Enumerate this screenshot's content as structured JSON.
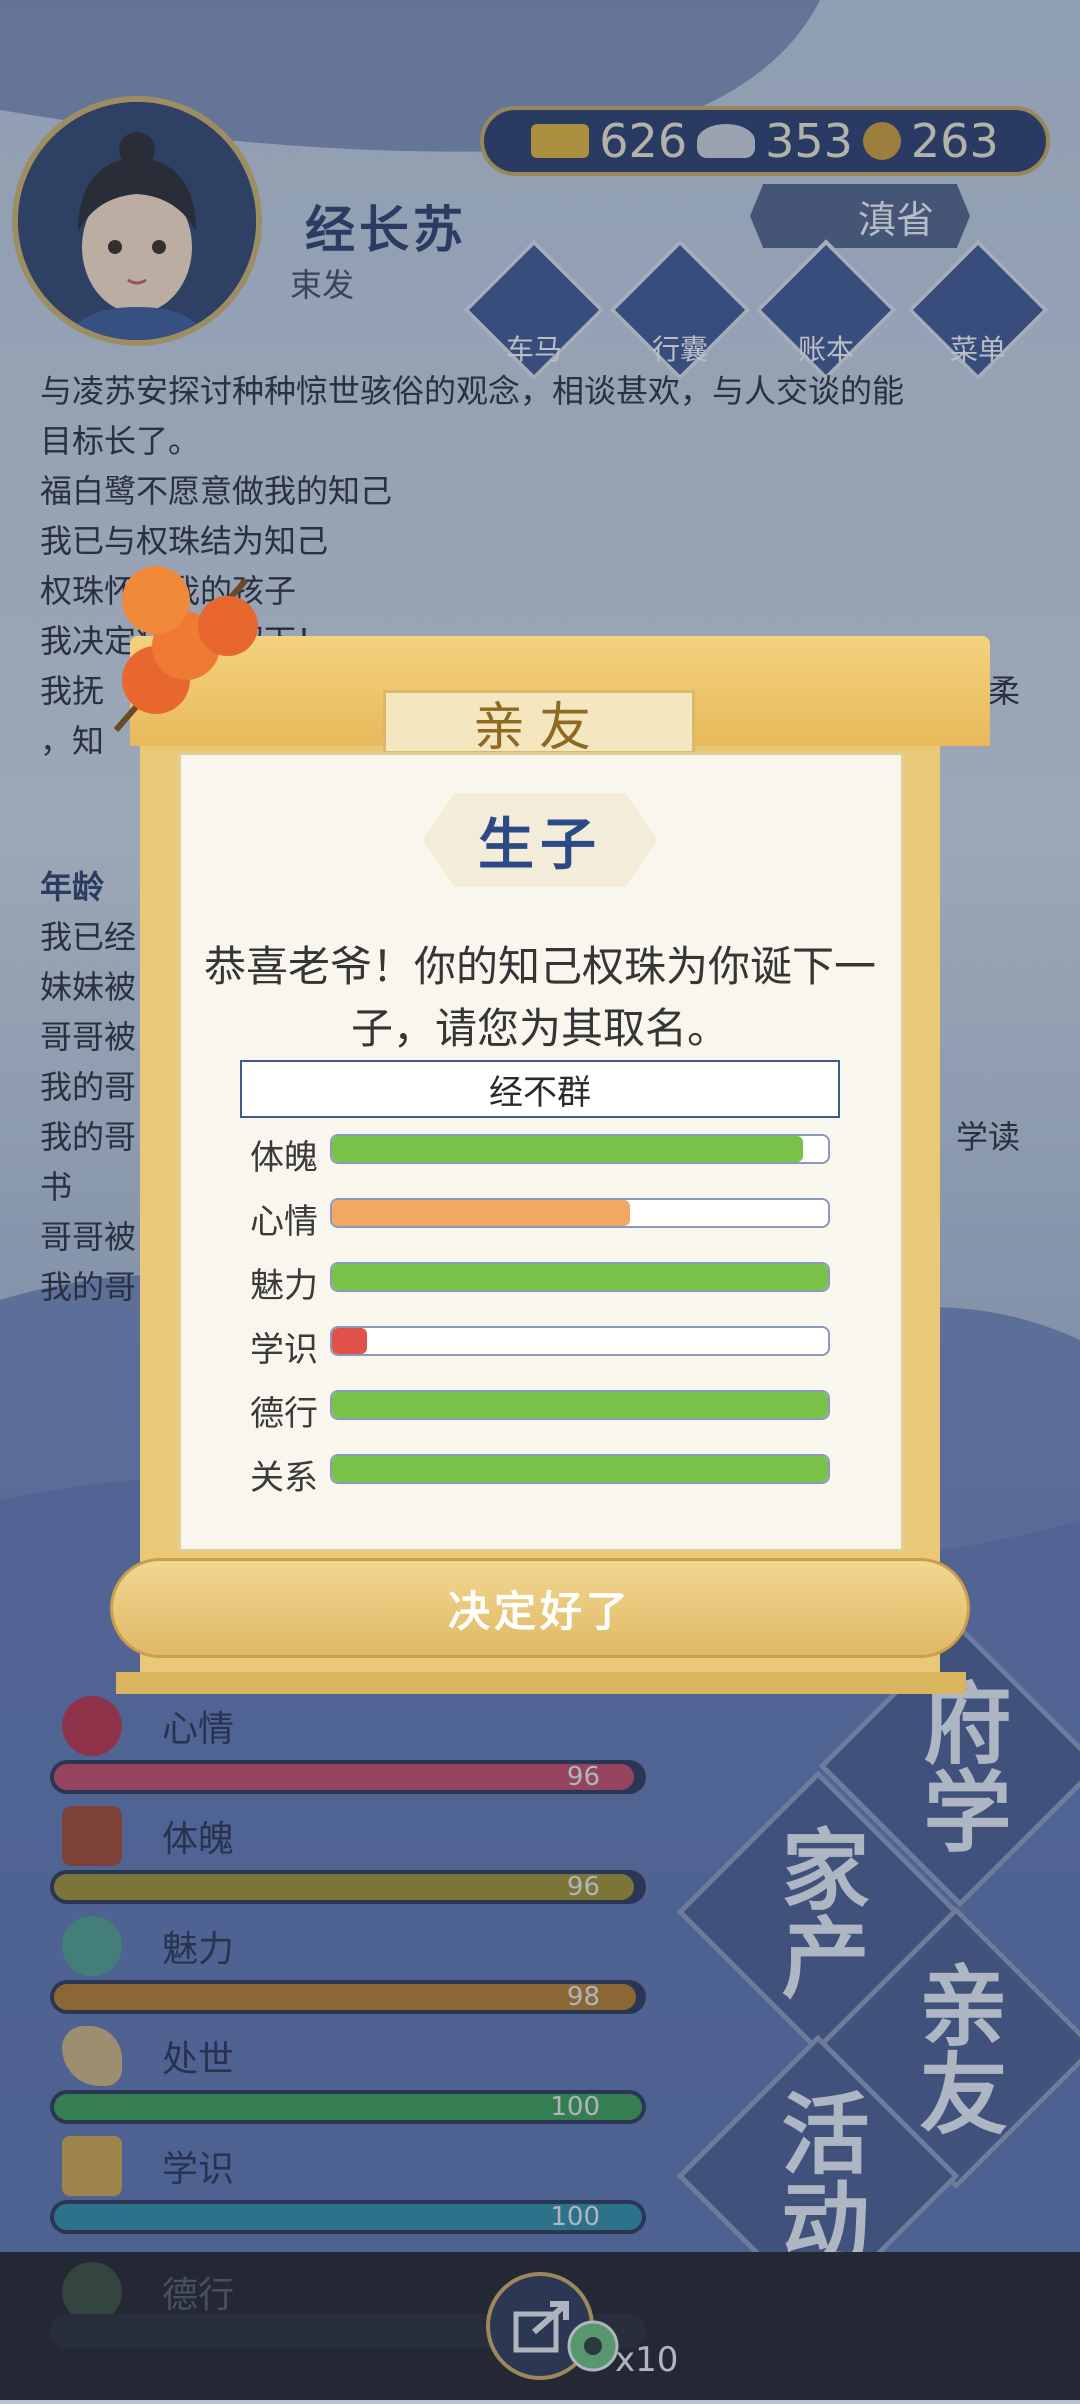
{
  "player": {
    "name": "经长苏",
    "title": "束发"
  },
  "currency": {
    "gold": "626",
    "silver": "353",
    "coin": "263"
  },
  "region": {
    "label": "滇省"
  },
  "menu": [
    {
      "label": "车马",
      "icon": "carriage-icon"
    },
    {
      "label": "行囊",
      "icon": "bag-icon"
    },
    {
      "label": "账本",
      "icon": "ledger-icon"
    },
    {
      "label": "菜单",
      "icon": "more-icon"
    }
  ],
  "log": [
    "与凌苏安探讨种种惊世骇俗的观念，相谈甚欢，与人交谈的能",
    "目标长了。",
    "福白鹭不愿意做我的知己",
    "我已与权珠结为知己",
    "权珠怀了我的孩子",
    "我决定将孩子留下！",
    "我抚",
    "，知",
    "年龄",
    "我已经",
    "妹妹被",
    "哥哥被",
    "我的哥",
    "我的哥",
    "书",
    "哥哥被",
    "我的哥"
  ],
  "log_right": {
    "line7": "温柔",
    "line13": "学读"
  },
  "stats": [
    {
      "label": "心情",
      "value": 96,
      "icon": "flower-icon",
      "color": "#c04a63"
    },
    {
      "label": "体魄",
      "value": 96,
      "icon": "body-icon",
      "color": "#9c8f2e"
    },
    {
      "label": "魅力",
      "value": 98,
      "icon": "charm-icon",
      "color": "#b07a2a"
    },
    {
      "label": "处世",
      "value": 100,
      "icon": "hat-icon",
      "color": "#3a9a53"
    },
    {
      "label": "学识",
      "value": 100,
      "icon": "books-icon",
      "color": "#2f8aa2"
    },
    {
      "label": "德行",
      "value": 0,
      "icon": "virtue-icon",
      "color": "#444444"
    }
  ],
  "side_buttons": [
    {
      "label": "府学"
    },
    {
      "label": "家产"
    },
    {
      "label": "亲友"
    },
    {
      "label": "活动"
    }
  ],
  "share": {
    "count": "x10"
  },
  "dialog": {
    "title": "亲友",
    "subtitle": "生子",
    "message": "恭喜老爷！你的知己权珠为你诞下一子，请您为其取名。",
    "name_value": "经不群",
    "attributes": [
      {
        "label": "体魄",
        "fraction": 0.95,
        "color": "#79c24a"
      },
      {
        "label": "心情",
        "fraction": 0.6,
        "color": "#f2a862"
      },
      {
        "label": "魅力",
        "fraction": 1.0,
        "color": "#79c24a"
      },
      {
        "label": "学识",
        "fraction": 0.07,
        "color": "#e0514a"
      },
      {
        "label": "德行",
        "fraction": 1.0,
        "color": "#79c24a"
      },
      {
        "label": "关系",
        "fraction": 1.0,
        "color": "#79c24a"
      }
    ],
    "confirm_label": "决定好了"
  }
}
